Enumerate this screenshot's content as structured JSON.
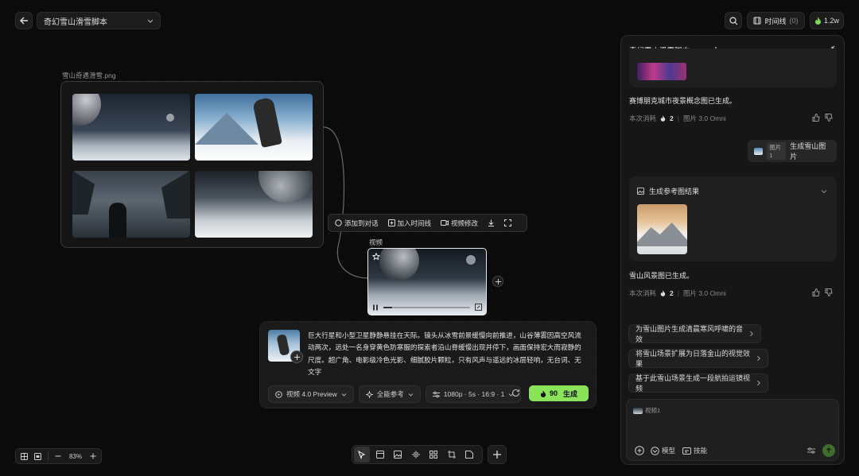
{
  "topbar": {
    "project_title": "奇幻雪山滑雪脚本",
    "timeline_label": "时间线",
    "timeline_count": "(0)",
    "credits": "1.2w"
  },
  "canvas": {
    "image_node_label": "雪山奇遇滑雪.png",
    "video_node_label": "视频",
    "zoom": "83%",
    "toolbar": {
      "add_to_chat": "添加到对话",
      "add_to_timeline": "加入时间线",
      "video_edit": "视频修改"
    }
  },
  "prompt": {
    "text": "巨大行星和小型卫星静静悬挂在天际。镜头从冰雪前景缓慢向前推进，山谷薄雾因高空风流动两次，远处一名身穿黄色防寒服的探索者沿山脊缓慢出现并停下，画面保持宏大而寂静的尺度。超广角、电影级冷色光影、细腻胶片颗粒，只有风声与遥远的冰层轻响，无台词、无文字",
    "model": "视频 4.0 Preview",
    "reference": "全能参考",
    "settings": "1080p · 5s · 16:9 · 1",
    "cost": "90",
    "generate": "生成"
  },
  "chat": {
    "title": "奇幻雪山滑雪脚本",
    "msg1": "赛博朋克城市夜景概念图已生成。",
    "meta1_label": "本次消耗",
    "meta1_cost": "2",
    "meta1_model": "图片 3.0 Omni",
    "user_chip": "图片1",
    "user_msg": "生成雪山图片",
    "result_title": "生成参考图结果",
    "msg2": "雪山风景图已生成。",
    "meta2_label": "本次消耗",
    "meta2_cost": "2",
    "meta2_model": "图片 3.0 Omni",
    "suggestions": [
      "为雪山图片生成清晨寒风呼啸的音效",
      "将雪山场景扩展为日落金山的视觉效果",
      "基于此雪山场景生成一段航拍运镜视频"
    ],
    "input_chip": "视频1",
    "model_label": "模型",
    "skill_label": "技能"
  }
}
